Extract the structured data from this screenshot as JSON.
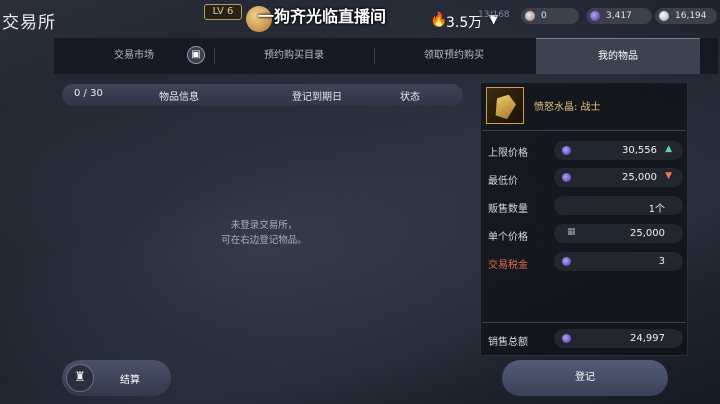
{
  "header": {
    "page_title": "交易所",
    "level_badge": "LV 6",
    "streamer_name": "一狗齐光临直播间",
    "heat_value": "3.5万",
    "inventory_count": "13/168",
    "currencies": [
      {
        "icon": "pearl-icon",
        "value": "0",
        "color": "#d9c9c0"
      },
      {
        "icon": "purple-gem-icon",
        "value": "3,417",
        "color": "#7a55d8"
      },
      {
        "icon": "silver-coin-icon",
        "value": "16,194",
        "color": "#c9d6e6"
      }
    ]
  },
  "tabs": [
    {
      "label": "交易市场",
      "active": false
    },
    {
      "label": "预约购买目录",
      "active": false
    },
    {
      "label": "领取预约购买",
      "active": false
    },
    {
      "label": "我的物品",
      "active": true
    }
  ],
  "list": {
    "count": "0 / 30",
    "col_item_info": "物品信息",
    "col_expiry": "登记到期日",
    "col_status": "状态",
    "empty_line1": "未登录交易所，",
    "empty_line2": "可在右边登记物品。"
  },
  "panel": {
    "item_name": "愤怒水晶: 战士",
    "rows": [
      {
        "label": "上限价格",
        "value": "30,556",
        "trend": "up"
      },
      {
        "label": "最低价",
        "value": "25,000",
        "trend": "down"
      },
      {
        "label": "贩售数量",
        "value": "1个"
      },
      {
        "label": "单个价格",
        "value": "25,000"
      },
      {
        "label": "交易税金",
        "value": "3"
      }
    ],
    "total_label": "销售总额",
    "total_value": "24,997"
  },
  "buttons": {
    "settle": "结算",
    "register": "登记"
  },
  "colors": {
    "accent_gold": "#e3c27c",
    "tax_red": "#e06a4e",
    "up_teal": "#5bd6b5",
    "down_orange": "#ef7a55"
  }
}
